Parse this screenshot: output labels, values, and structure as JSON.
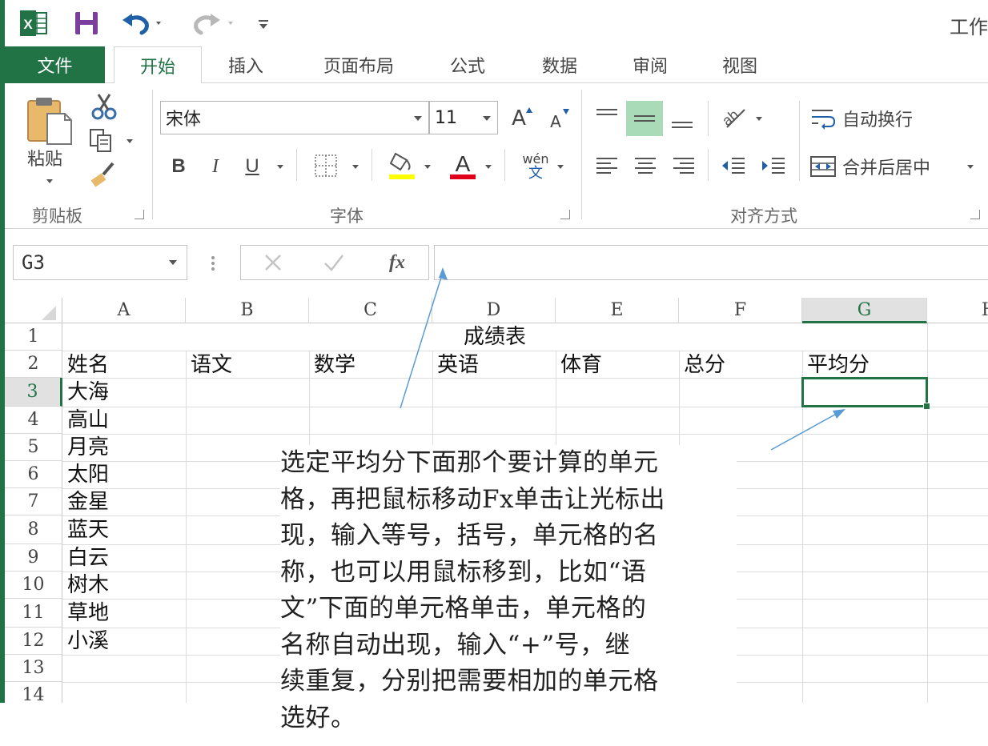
{
  "window": {
    "title": "工作"
  },
  "colors": {
    "excel_green": "#217346",
    "selected_cell_border": "#217346",
    "highlight_yellow": "#ffff00",
    "font_red": "#e0001a",
    "arrow_blue": "#5b9bd5"
  },
  "quick_access": {
    "icons": [
      "excel-logo-icon",
      "save-icon",
      "undo-icon",
      "redo-icon",
      "customize-qat-icon"
    ]
  },
  "tabs": {
    "file": "文件",
    "items": [
      {
        "label": "开始",
        "active": true
      },
      {
        "label": "插入"
      },
      {
        "label": "页面布局"
      },
      {
        "label": "公式"
      },
      {
        "label": "数据"
      },
      {
        "label": "审阅"
      },
      {
        "label": "视图"
      }
    ]
  },
  "ribbon": {
    "clipboard": {
      "paste_label": "粘贴",
      "group_label": "剪贴板"
    },
    "font": {
      "font_name": "宋体",
      "font_size": "11",
      "bold": "B",
      "italic": "I",
      "underline": "U",
      "phonetic_top": "wén",
      "phonetic_bottom": "文",
      "font_color_glyph": "A",
      "grow_glyph": "A",
      "shrink_glyph": "A",
      "group_label": "字体"
    },
    "alignment": {
      "wrap_text": "自动换行",
      "merge_center": "合并后居中",
      "group_label": "对齐方式"
    }
  },
  "formula_bar": {
    "name_box": "G3",
    "fx_label": "fx",
    "formula": ""
  },
  "sheet": {
    "columns": [
      "A",
      "B",
      "C",
      "D",
      "E",
      "F",
      "G",
      "H"
    ],
    "rows": [
      "1",
      "2",
      "3",
      "4",
      "5",
      "6",
      "7",
      "8",
      "9",
      "10",
      "11",
      "12",
      "13",
      "14"
    ],
    "title": "成绩表",
    "headers": [
      "姓名",
      "语文",
      "数学",
      "英语",
      "体育",
      "总分",
      "平均分"
    ],
    "names": [
      "大海",
      "高山",
      "月亮",
      "太阳",
      "金星",
      "蓝天",
      "白云",
      "树木",
      "草地",
      "小溪"
    ],
    "selected_cell": "G3"
  },
  "annotation": {
    "lines": [
      "选定平均分下面那个要计算的单元",
      "格，再把鼠标移动Fx单击让光标出",
      "现，输入等号，括号，单元格的名",
      "称，也可以用鼠标移到，比如“语",
      "文”下面的单元格单击，单元格的",
      "名称自动出现，输入“+”号，继",
      "续重复，分别把需要相加的单元格",
      "选好。"
    ]
  }
}
